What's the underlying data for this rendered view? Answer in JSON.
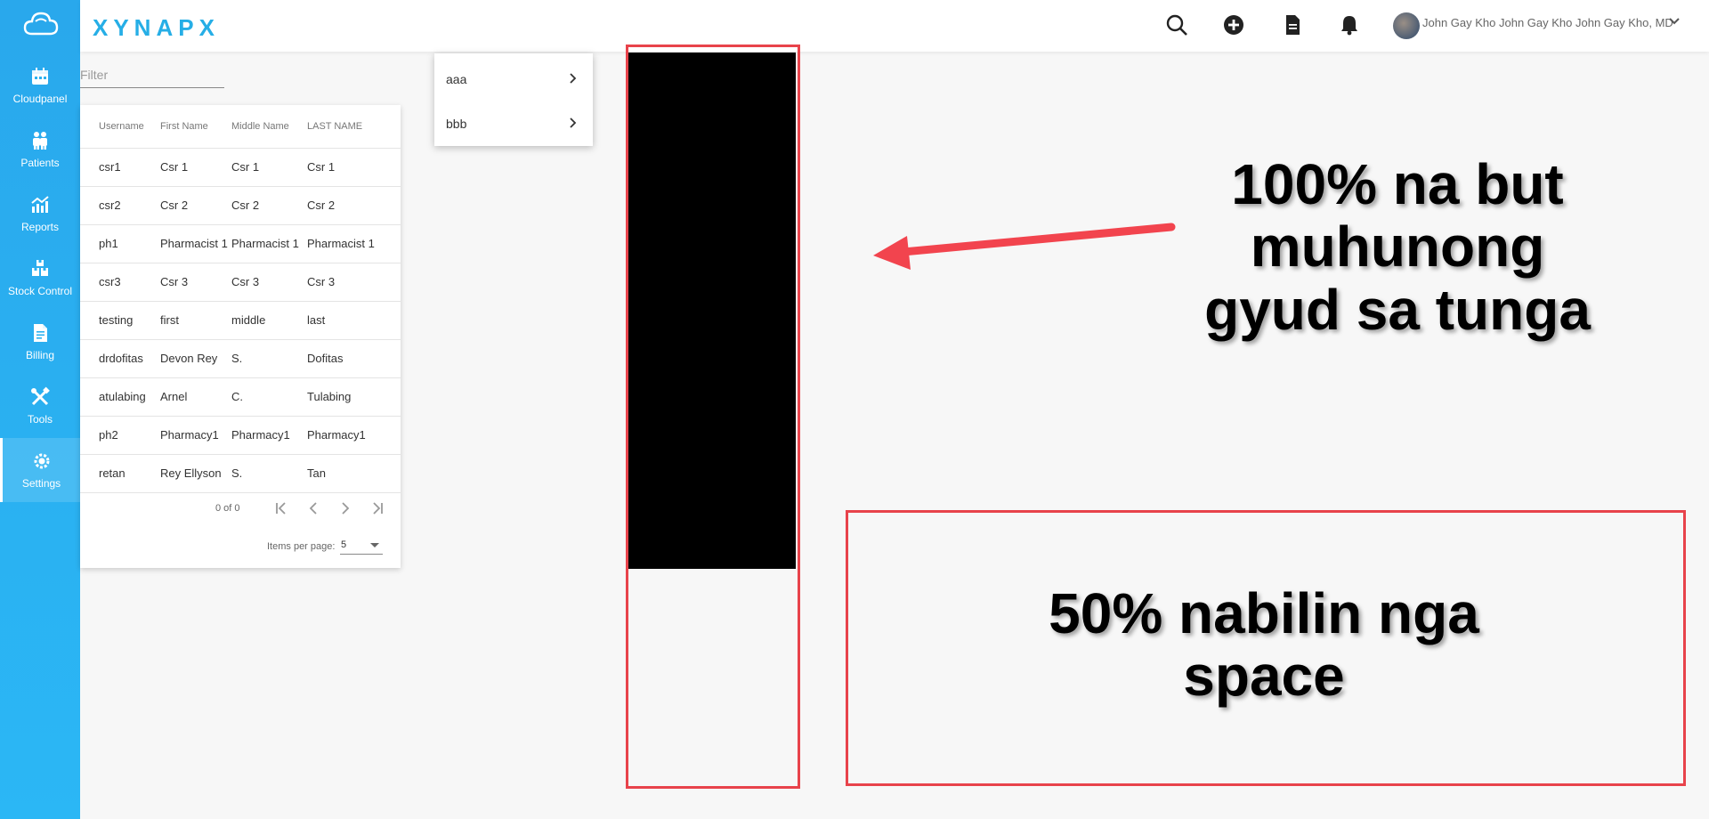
{
  "brand": "XYNAPX",
  "colors": {
    "sidebar": "#2bb1f0",
    "accent": "#26aee6",
    "annotation_red": "#e8434b"
  },
  "sidebar": {
    "items": [
      {
        "label": "Cloudpanel",
        "icon": "calendar-icon"
      },
      {
        "label": "Patients",
        "icon": "people-icon"
      },
      {
        "label": "Reports",
        "icon": "chart-icon"
      },
      {
        "label": "Stock Control",
        "icon": "boxes-icon"
      },
      {
        "label": "Billing",
        "icon": "document-icon"
      },
      {
        "label": "Tools",
        "icon": "tools-icon"
      },
      {
        "label": "Settings",
        "icon": "settings-icon",
        "active": true
      }
    ]
  },
  "header": {
    "user_name": "John Gay Kho John Gay Kho John Gay Kho, MD",
    "icons": [
      "search-icon",
      "add-circle-icon",
      "document-icon",
      "bell-icon",
      "chevron-down-icon"
    ]
  },
  "filter": {
    "placeholder": "Filter",
    "value": ""
  },
  "table": {
    "columns": [
      "Username",
      "First Name",
      "Middle Name",
      "LAST NAME"
    ],
    "rows": [
      [
        "csr1",
        "Csr 1",
        "Csr 1",
        "Csr 1"
      ],
      [
        "csr2",
        "Csr 2",
        "Csr 2",
        "Csr 2"
      ],
      [
        "ph1",
        "Pharmacist 1",
        "Pharmacist 1",
        "Pharmacist 1"
      ],
      [
        "csr3",
        "Csr 3",
        "Csr 3",
        "Csr 3"
      ],
      [
        "testing",
        "first",
        "middle",
        "last"
      ],
      [
        "drdofitas",
        "Devon Rey",
        "S.",
        "Dofitas"
      ],
      [
        "atulabing",
        "Arnel",
        "C.",
        "Tulabing"
      ],
      [
        "ph2",
        "Pharmacy1",
        "Pharmacy1",
        "Pharmacy1"
      ],
      [
        "retan",
        "Rey Ellyson",
        "S.",
        "Tan"
      ]
    ],
    "paginator": {
      "range": "0 of 0",
      "items_per_page_label": "Items per page:",
      "items_per_page": "5"
    }
  },
  "menu": {
    "items": [
      {
        "label": "aaa"
      },
      {
        "label": "bbb"
      }
    ]
  },
  "annotations": {
    "top_text": "100% na but muhunong gyud sa tunga",
    "bottom_text": "50% nabilin nga space"
  }
}
